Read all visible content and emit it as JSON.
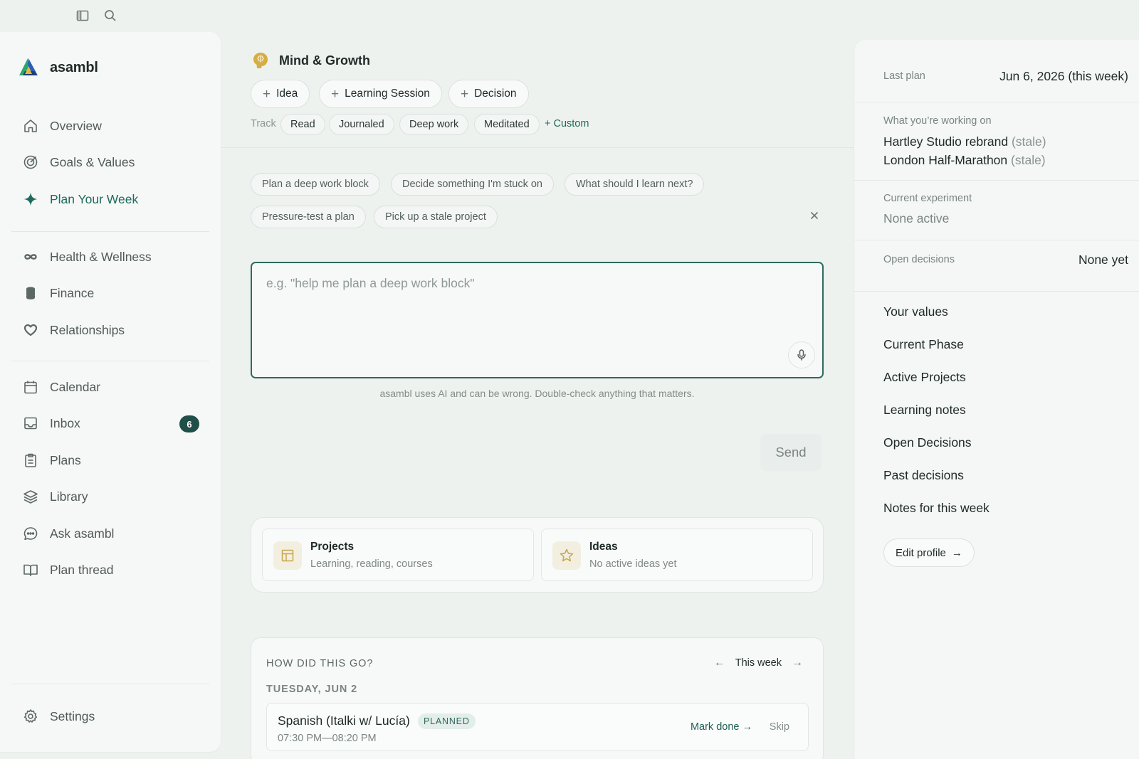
{
  "app": {
    "name": "asambl"
  },
  "topbar": {
    "icons": [
      "sidebar-toggle-icon",
      "search-icon"
    ]
  },
  "sidebar": {
    "nav_top": [
      {
        "label": "Overview",
        "icon": "home-icon"
      },
      {
        "label": "Goals & Values",
        "icon": "target-icon"
      },
      {
        "label": "Plan Your Week",
        "icon": "sparkle-icon",
        "active": true
      }
    ],
    "nav_areas": [
      {
        "label": "Health & Wellness",
        "icon": "infinity-icon"
      },
      {
        "label": "Finance",
        "icon": "coins-icon"
      },
      {
        "label": "Relationships",
        "icon": "heart-icon"
      }
    ],
    "nav_tools": [
      {
        "label": "Calendar",
        "icon": "calendar-icon"
      },
      {
        "label": "Inbox",
        "icon": "inbox-icon",
        "badge": "6"
      },
      {
        "label": "Plans",
        "icon": "clipboard-icon"
      },
      {
        "label": "Library",
        "icon": "layers-icon"
      },
      {
        "label": "Ask asambl",
        "icon": "chat-icon"
      },
      {
        "label": "Plan thread",
        "icon": "book-icon"
      }
    ],
    "settings": {
      "label": "Settings",
      "icon": "gear-icon"
    }
  },
  "main": {
    "hub_title": "Mind & Growth",
    "add_buttons": [
      {
        "label": "Idea"
      },
      {
        "label": "Learning Session"
      },
      {
        "label": "Decision"
      }
    ],
    "track": {
      "label": "Track",
      "chips": [
        "Read",
        "Journaled",
        "Deep work",
        "Meditated"
      ],
      "custom_label": "+ Custom"
    },
    "suggestions": [
      "Plan a deep work block",
      "Decide something I'm stuck on",
      "What should I learn next?",
      "Pressure-test a plan",
      "Pick up a stale project"
    ],
    "prompt": {
      "placeholder": "e.g. \"help me plan a deep work block\"",
      "disclaimer": "asambl uses AI and can be wrong. Double-check anything that matters.",
      "send_label": "Send"
    },
    "cards": [
      {
        "title": "Projects",
        "subtitle": "Learning, reading, courses",
        "icon": "table-icon"
      },
      {
        "title": "Ideas",
        "subtitle": "No active ideas yet",
        "icon": "star-icon"
      }
    ],
    "review": {
      "heading": "HOW DID THIS GO?",
      "period": "This week",
      "date": "TUESDAY, JUN 2",
      "session": {
        "name": "Spanish (Italki w/ Lucía)",
        "status": "PLANNED",
        "time": "07:30 PM—08:20 PM",
        "mark_done": "Mark done →",
        "skip": "Skip"
      }
    }
  },
  "right_panel": {
    "last_plan": {
      "label": "Last plan",
      "value": "Jun 6, 2026 (this week)"
    },
    "working_on": {
      "label": "What you’re working on",
      "items": [
        {
          "name": "Hartley Studio rebrand",
          "tag": "(stale)"
        },
        {
          "name": "London Half-Marathon",
          "tag": "(stale)"
        }
      ]
    },
    "experiment": {
      "label": "Current experiment",
      "value": "None active"
    },
    "open_decisions": {
      "label": "Open decisions",
      "value": "None yet"
    },
    "links": [
      "Your values",
      "Current Phase",
      "Active Projects",
      "Learning notes",
      "Open Decisions",
      "Past decisions",
      "Notes for this week"
    ],
    "edit_profile": "Edit profile"
  },
  "colors": {
    "accent": "#1f6b5c",
    "badge": "#1f4f47",
    "icon_gold": "#c8a54b"
  }
}
